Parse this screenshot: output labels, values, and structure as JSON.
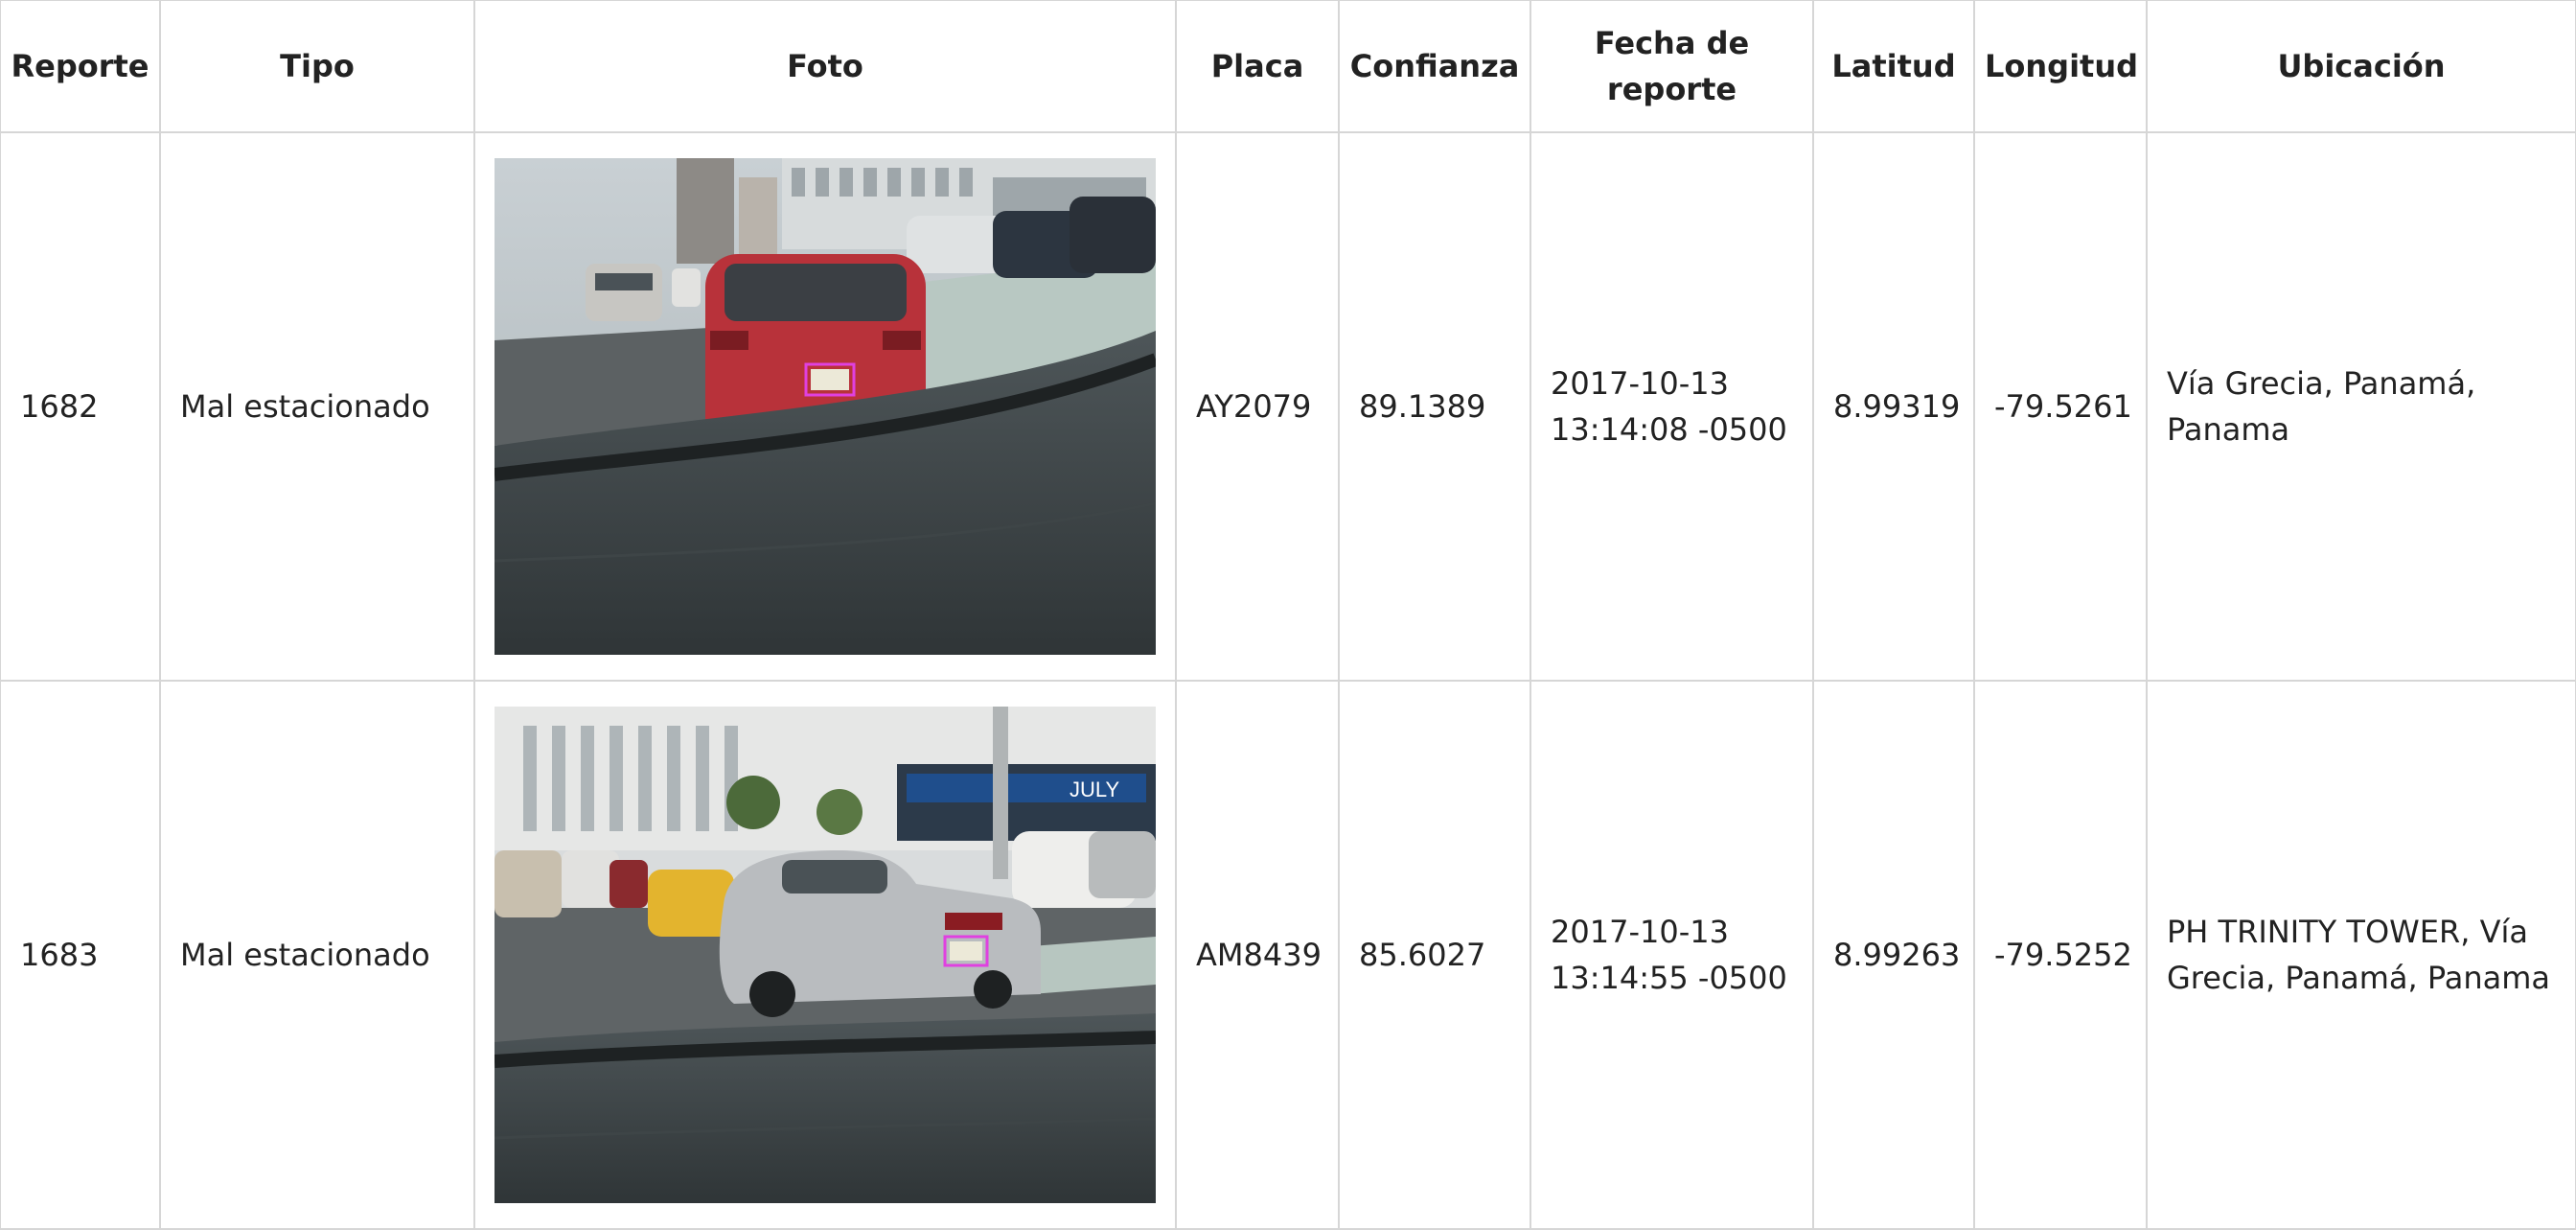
{
  "table": {
    "headers": {
      "reporte": "Reporte",
      "tipo": "Tipo",
      "foto": "Foto",
      "placa": "Placa",
      "confianza": "Confianza",
      "fecha_line1": "Fecha de",
      "fecha_line2": "reporte",
      "latitud": "Latitud",
      "longitud": "Longitud",
      "ubicacion": "Ubicación"
    },
    "rows": [
      {
        "reporte": "1682",
        "tipo": "Mal estacionado",
        "placa": "AY2079",
        "confianza": "89.1389",
        "fecha_line1": "2017-10-13",
        "fecha_line2": "13:14:08 -0500",
        "latitud": "8.99319",
        "longitud": "-79.5261",
        "ubicacion": "Vía Grecia, Panamá, Panama",
        "photo": {
          "car_color": "#b8323a",
          "scene": "red-suv-highway"
        }
      },
      {
        "reporte": "1683",
        "tipo": "Mal estacionado",
        "placa": "AM8439",
        "confianza": "85.6027",
        "fecha_line1": "2017-10-13",
        "fecha_line2": "13:14:55 -0500",
        "latitud": "8.99263",
        "longitud": "-79.5252",
        "ubicacion": "PH TRINITY TOWER, Vía Grecia, Panamá, Panama",
        "photo": {
          "car_color": "#b9bcbf",
          "scene": "silver-sedan-parking"
        }
      }
    ]
  },
  "colors": {
    "border": "#d6d6d6",
    "plate_box": "#e040e0",
    "text": "#222222"
  }
}
